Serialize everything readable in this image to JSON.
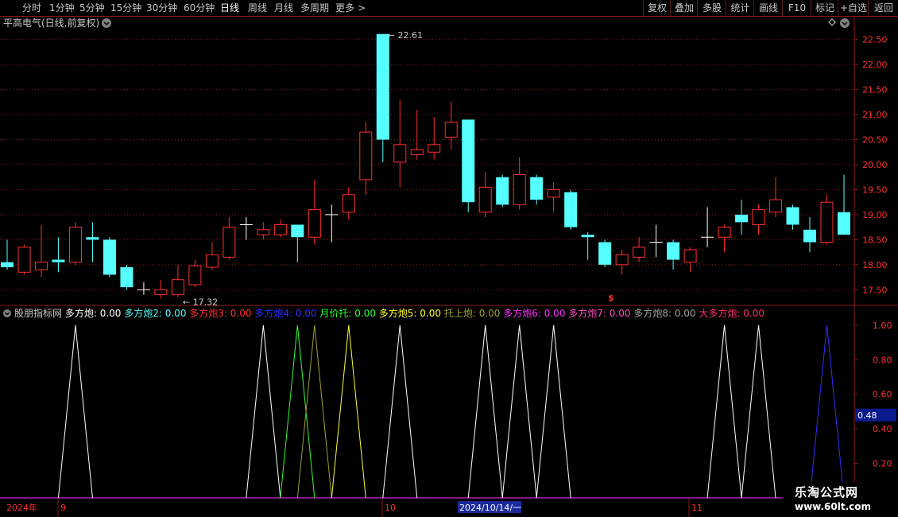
{
  "toolbar": {
    "periods": [
      {
        "label": "分时",
        "active": false
      },
      {
        "label": "1分钟",
        "active": false
      },
      {
        "label": "5分钟",
        "active": false
      },
      {
        "label": "15分钟",
        "active": false
      },
      {
        "label": "30分钟",
        "active": false
      },
      {
        "label": "60分钟",
        "active": false
      },
      {
        "label": "日线",
        "active": true
      },
      {
        "label": "周线",
        "active": false
      },
      {
        "label": "月线",
        "active": false
      },
      {
        "label": "多周期",
        "active": false
      },
      {
        "label": "更多",
        "active": false
      }
    ],
    "more_arrow": ">",
    "actions": [
      "复权",
      "叠加",
      "多股",
      "统计",
      "画线",
      "F10",
      "标记",
      "+自选",
      "返回"
    ]
  },
  "stock_title": "平高电气(日线,前复权)",
  "max_label": "22.61",
  "min_label": "17.32",
  "price_axis": [
    "22.50",
    "22.00",
    "21.50",
    "21.00",
    "20.50",
    "20.00",
    "19.50",
    "19.00",
    "18.50",
    "18.00",
    "17.50"
  ],
  "dollar_marker": "$",
  "indicator_title": "股朋指标网",
  "indicator_series": [
    {
      "label": "多方炮:",
      "value": "0.00",
      "color": "#ffffff"
    },
    {
      "label": "多方炮2:",
      "value": "0.00",
      "color": "#55ffff"
    },
    {
      "label": "多方炮3:",
      "value": "0.00",
      "color": "#ff3030"
    },
    {
      "label": "多方炮4:",
      "value": "0.00",
      "color": "#3030ff"
    },
    {
      "label": "月价托:",
      "value": "0.00",
      "color": "#30ff30"
    },
    {
      "label": "多方炮5:",
      "value": "0.00",
      "color": "#ffff30"
    },
    {
      "label": "托上炮:",
      "value": "0.00",
      "color": "#a0a030"
    },
    {
      "label": "多方炮6:",
      "value": "0.00",
      "color": "#ff30ff"
    },
    {
      "label": "多方炮7:",
      "value": "0.00",
      "color": "#ff50c0"
    },
    {
      "label": "多方炮8:",
      "value": "0.00",
      "color": "#a0a0a0"
    },
    {
      "label": "大多方炮:",
      "value": "0.00",
      "color": "#ff3070"
    }
  ],
  "indicator_axis": [
    "1.00",
    "0.80",
    "0.60",
    "0.40",
    "0.20"
  ],
  "indicator_current": "0.48",
  "date_axis": {
    "year": "2024年",
    "months": [
      "9",
      "10",
      "11"
    ],
    "cursor": "2024/10/14/一"
  },
  "watermark": {
    "line1": "乐淘公式网",
    "line2": "www.60lt.com"
  },
  "colors": {
    "up": "#ff3030",
    "down": "#55ffff",
    "grid": "#8b1a1a",
    "axis_text": "#ff3030"
  },
  "chart_data": {
    "type": "candlestick",
    "candles": [
      {
        "o": 18.05,
        "c": 17.95,
        "h": 18.5,
        "l": 17.9
      },
      {
        "o": 17.85,
        "c": 18.35,
        "h": 18.4,
        "l": 17.8
      },
      {
        "o": 17.9,
        "c": 18.05,
        "h": 18.8,
        "l": 17.75
      },
      {
        "o": 18.1,
        "c": 18.05,
        "h": 18.55,
        "l": 17.85
      },
      {
        "o": 18.05,
        "c": 18.75,
        "h": 18.85,
        "l": 18.0
      },
      {
        "o": 18.55,
        "c": 18.5,
        "h": 18.85,
        "l": 18.05
      },
      {
        "o": 18.5,
        "c": 17.8,
        "h": 18.55,
        "l": 17.75
      },
      {
        "o": 17.95,
        "c": 17.55,
        "h": 18.0,
        "l": 17.5
      },
      {
        "o": 17.5,
        "c": 17.5,
        "h": 17.65,
        "l": 17.4
      },
      {
        "o": 17.4,
        "c": 17.5,
        "h": 17.7,
        "l": 17.32
      },
      {
        "o": 17.4,
        "c": 17.7,
        "h": 18.0,
        "l": 17.35
      },
      {
        "o": 17.6,
        "c": 17.98,
        "h": 18.1,
        "l": 17.55
      },
      {
        "o": 17.95,
        "c": 18.2,
        "h": 18.45,
        "l": 17.9
      },
      {
        "o": 18.15,
        "c": 18.75,
        "h": 18.95,
        "l": 18.1
      },
      {
        "o": 18.8,
        "c": 18.8,
        "h": 18.95,
        "l": 18.5
      },
      {
        "o": 18.6,
        "c": 18.7,
        "h": 18.85,
        "l": 18.5
      },
      {
        "o": 18.6,
        "c": 18.8,
        "h": 18.9,
        "l": 18.55
      },
      {
        "o": 18.8,
        "c": 18.55,
        "h": 18.8,
        "l": 18.05
      },
      {
        "o": 18.55,
        "c": 19.1,
        "h": 19.7,
        "l": 18.4
      },
      {
        "o": 19.0,
        "c": 19.0,
        "h": 19.2,
        "l": 18.45
      },
      {
        "o": 19.05,
        "c": 19.4,
        "h": 19.55,
        "l": 18.9
      },
      {
        "o": 19.7,
        "c": 20.65,
        "h": 20.85,
        "l": 19.4
      },
      {
        "o": 22.61,
        "c": 20.5,
        "h": 22.61,
        "l": 20.05
      },
      {
        "o": 20.05,
        "c": 20.4,
        "h": 21.3,
        "l": 19.55
      },
      {
        "o": 20.2,
        "c": 20.3,
        "h": 21.1,
        "l": 20.1
      },
      {
        "o": 20.25,
        "c": 20.4,
        "h": 20.95,
        "l": 20.1
      },
      {
        "o": 20.55,
        "c": 20.85,
        "h": 21.25,
        "l": 20.3
      },
      {
        "o": 20.9,
        "c": 19.25,
        "h": 20.9,
        "l": 19.05
      },
      {
        "o": 19.05,
        "c": 19.55,
        "h": 19.85,
        "l": 18.95
      },
      {
        "o": 19.75,
        "c": 19.2,
        "h": 19.8,
        "l": 19.15
      },
      {
        "o": 19.2,
        "c": 19.8,
        "h": 20.15,
        "l": 19.1
      },
      {
        "o": 19.75,
        "c": 19.3,
        "h": 19.8,
        "l": 19.2
      },
      {
        "o": 19.35,
        "c": 19.5,
        "h": 19.65,
        "l": 19.05
      },
      {
        "o": 19.45,
        "c": 18.75,
        "h": 19.5,
        "l": 18.7
      },
      {
        "o": 18.6,
        "c": 18.55,
        "h": 18.65,
        "l": 18.1
      },
      {
        "o": 18.45,
        "c": 18.0,
        "h": 18.5,
        "l": 17.95
      },
      {
        "o": 18.0,
        "c": 18.2,
        "h": 18.3,
        "l": 17.8
      },
      {
        "o": 18.15,
        "c": 18.35,
        "h": 18.55,
        "l": 18.05
      },
      {
        "o": 18.45,
        "c": 18.45,
        "h": 18.8,
        "l": 18.15
      },
      {
        "o": 18.45,
        "c": 18.1,
        "h": 18.5,
        "l": 17.9
      },
      {
        "o": 18.05,
        "c": 18.3,
        "h": 18.35,
        "l": 17.85
      },
      {
        "o": 18.55,
        "c": 18.55,
        "h": 19.15,
        "l": 18.35
      },
      {
        "o": 18.55,
        "c": 18.75,
        "h": 18.8,
        "l": 18.25
      },
      {
        "o": 19.0,
        "c": 18.85,
        "h": 19.3,
        "l": 18.6
      },
      {
        "o": 18.8,
        "c": 19.1,
        "h": 19.2,
        "l": 18.6
      },
      {
        "o": 19.05,
        "c": 19.3,
        "h": 19.75,
        "l": 18.95
      },
      {
        "o": 19.15,
        "c": 18.8,
        "h": 19.2,
        "l": 18.7
      },
      {
        "o": 18.7,
        "c": 18.45,
        "h": 18.95,
        "l": 18.25
      },
      {
        "o": 18.45,
        "c": 19.25,
        "h": 19.4,
        "l": 18.4
      },
      {
        "o": 19.05,
        "c": 18.6,
        "h": 19.8,
        "l": 18.6
      }
    ],
    "ylim": [
      17.25,
      22.75
    ],
    "indicator_ylim": [
      0,
      1.05
    ],
    "signals": [
      {
        "center": 4,
        "series": 0
      },
      {
        "center": 15,
        "series": 0
      },
      {
        "center": 17,
        "series": 4
      },
      {
        "center": 18,
        "series": 6
      },
      {
        "center": 20,
        "series": 5
      },
      {
        "center": 23,
        "series": 0
      },
      {
        "center": 28,
        "series": 0
      },
      {
        "center": 30,
        "series": 0
      },
      {
        "center": 32,
        "series": 0
      },
      {
        "center": 42,
        "series": 0
      },
      {
        "center": 44,
        "series": 0
      },
      {
        "center": 48,
        "series": 3
      }
    ]
  }
}
